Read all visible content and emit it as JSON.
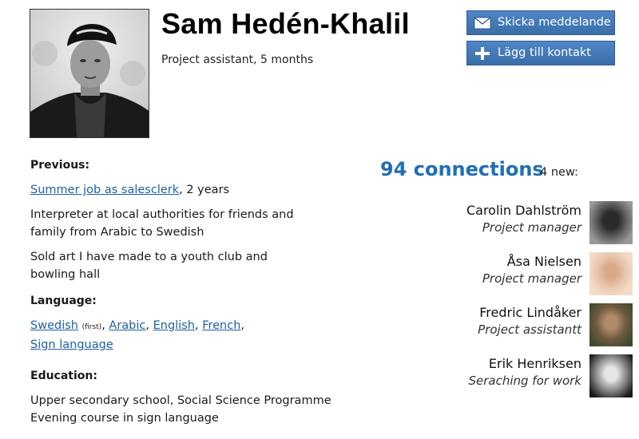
{
  "profile": {
    "name": "Sam Hedén-Khalil",
    "subtitle": "Project assistant, 5 months"
  },
  "actions": {
    "send_message": "Skicka meddelande",
    "add_contact": "Lägg till kontakt"
  },
  "previous": {
    "heading": "Previous:",
    "item1_link": "Summer job as salesclerk",
    "item1_rest": ", 2 years",
    "item2_line1": "Interpreter at local authorities for friends and",
    "item2_line2": "family from Arabic to Swedish",
    "item3_line1": "Sold art I have made to a youth club and",
    "item3_line2": "bowling hall"
  },
  "language": {
    "heading": "Language:",
    "items": [
      "Swedish",
      "Arabic",
      "English",
      "French",
      "Sign language"
    ],
    "first_note": "(first)",
    "separator": ","
  },
  "education": {
    "heading": "Education:",
    "line1": "Upper secondary school, Social Science Programme",
    "line2": "Evening course in sign language"
  },
  "connections": {
    "count_label": "94 connections",
    "new_label": "4 new:",
    "contacts": [
      {
        "name": "Carolin Dahlström",
        "role": "Project manager"
      },
      {
        "name": "Åsa Nielsen",
        "role": "Project manager"
      },
      {
        "name": "Fredric Lindåker",
        "role": "Project assistantt"
      },
      {
        "name": "Erik Henriksen",
        "role": "Seraching for work"
      }
    ]
  },
  "icons": {
    "message": "envelope-icon",
    "add": "plus-icon"
  },
  "colors": {
    "accent": "#1f6fb2",
    "link": "#1f5fa6",
    "button": "#3a6ea8"
  }
}
